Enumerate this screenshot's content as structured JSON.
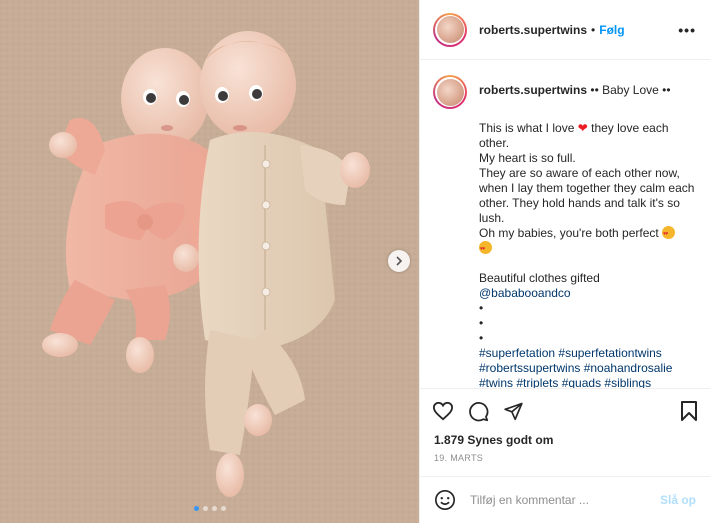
{
  "photo": {
    "alt": "Two babies lying on a carpet, one in a pink outfit and one in a beige romper",
    "carousel_dots": 4,
    "active_dot": 0,
    "next_icon": "chevron-right-icon"
  },
  "header": {
    "username": "roberts.supertwins",
    "separator": "•",
    "follow_label": "Følg",
    "more_label": "•••"
  },
  "caption": {
    "username": "roberts.supertwins",
    "title": "•• Baby Love ••",
    "line1_a": "This is what I love",
    "line1_b": "they love each other.",
    "line2": "My heart is so full.",
    "line3": "They are so aware of each other now, when I lay them together they calm each other. They hold hands and talk it's so lush.",
    "line4": "Oh my babies, you're both perfect",
    "line5": "Beautiful clothes gifted",
    "mention": "@bababooandco",
    "bullet": "•",
    "hashtags": "#superfetation #superfetationtwins #robertssupertwins #noahandrosalie #twins #triplets #quads #siblings #siblinglove #family #love #loveyou"
  },
  "actions": {
    "like_icon": "heart-outline-icon",
    "comment_icon": "comment-icon",
    "share_icon": "paper-plane-icon",
    "save_icon": "bookmark-icon"
  },
  "likes": "1.879 Synes godt om",
  "date": "19. MARTS",
  "comment_box": {
    "emoji_icon": "smiley-icon",
    "placeholder": "Tilføj en kommentar ...",
    "post_label": "Slå op"
  },
  "colors": {
    "accent": "#0095f6",
    "post_disabled": "#b2dffc",
    "heart": "#ed1c24",
    "active_dot": "#3897f0"
  }
}
